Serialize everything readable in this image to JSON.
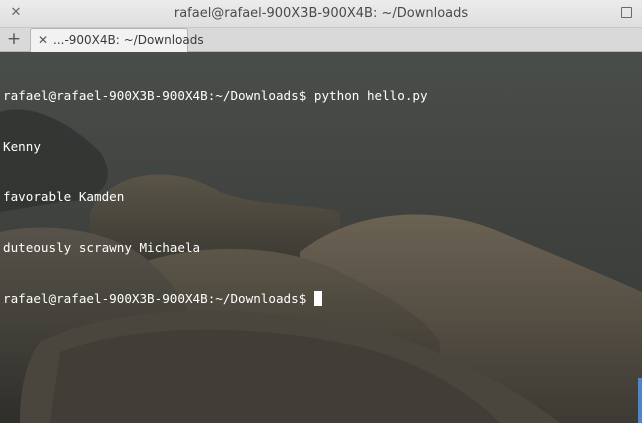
{
  "window": {
    "title": "rafael@rafael-900X3B-900X4B: ~/Downloads",
    "close_glyph": "✕",
    "maximize_icon": "maximize-icon"
  },
  "tabbar": {
    "new_tab_glyph": "+",
    "tabs": [
      {
        "label": "...-900X4B: ~/Downloads",
        "close_glyph": "✕"
      }
    ]
  },
  "terminal": {
    "lines": [
      "rafael@rafael-900X3B-900X4B:~/Downloads$ python hello.py",
      "Kenny",
      "favorable Kamden",
      "duteously scrawny Michaela",
      "rafael@rafael-900X3B-900X4B:~/Downloads$"
    ],
    "text_color": "#ffffff",
    "scrollbar_color": "#4f86c6"
  }
}
